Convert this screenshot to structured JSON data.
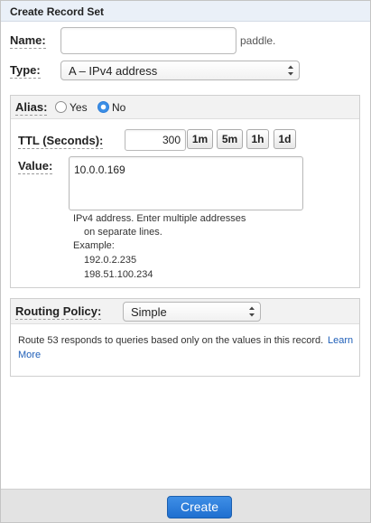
{
  "header": {
    "title": "Create Record Set"
  },
  "name": {
    "label": "Name:",
    "value": "",
    "suffix": "paddle."
  },
  "type": {
    "label": "Type:",
    "selected": "A – IPv4 address"
  },
  "alias": {
    "label": "Alias:",
    "yes": "Yes",
    "no": "No",
    "selected": "No"
  },
  "ttl": {
    "label": "TTL (Seconds):",
    "value": "300",
    "buttons": [
      "1m",
      "5m",
      "1h",
      "1d"
    ]
  },
  "value": {
    "label": "Value:",
    "text": "10.0.0.169",
    "help_line1": "IPv4 address. Enter multiple addresses",
    "help_line2": "on separate lines.",
    "example_label": "Example:",
    "example_1": "192.0.2.235",
    "example_2": "198.51.100.234"
  },
  "routing": {
    "label": "Routing Policy:",
    "selected": "Simple",
    "description": "Route 53 responds to queries based only on the values in this record.",
    "learn_more_1": "Learn",
    "learn_more_2": "More"
  },
  "footer": {
    "create_label": "Create"
  },
  "colors": {
    "accent": "#2f7fd9",
    "link": "#1f5fb8",
    "header_bg": "#eaf0f8"
  }
}
